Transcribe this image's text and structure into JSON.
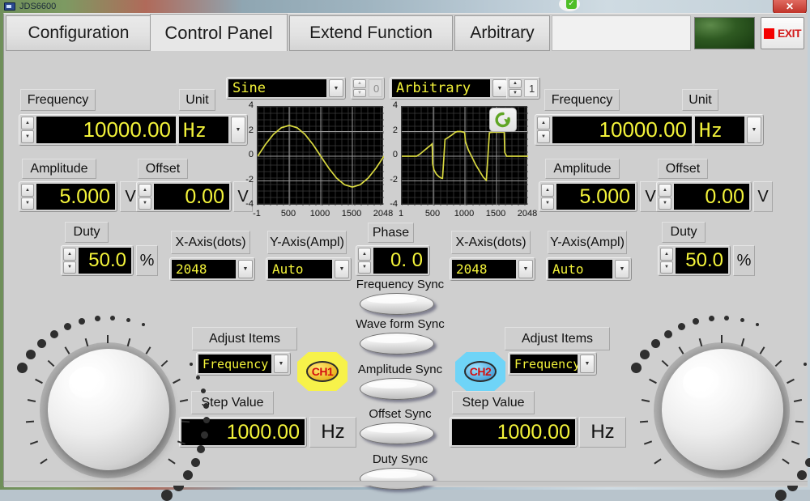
{
  "window": {
    "title": "JDS6600",
    "close_label": "✕"
  },
  "tabs": [
    {
      "label": "Configuration",
      "active": false
    },
    {
      "label": "Control Panel",
      "active": true
    },
    {
      "label": "Extend Function",
      "active": false
    },
    {
      "label": "Arbitrary",
      "active": false
    }
  ],
  "toolbar": {
    "exit_label": "EXIT",
    "exit_icon": "red-square-icon",
    "lamp_color": "#2f5a22"
  },
  "colors": {
    "lcd_bg": "#000000",
    "lcd_text": "#f3f33a",
    "panel_bg": "#cfcfcf",
    "exit_red": "#d21b1b",
    "ch1_badge": "#f7f24a",
    "ch2_badge": "#6fd4f7",
    "wave_trace": "#d8d840"
  },
  "ch1": {
    "waveform": {
      "value": "Sine",
      "index": "0",
      "index_disabled": true
    },
    "frequency": {
      "label": "Frequency",
      "value": "10000.00"
    },
    "unit": {
      "label": "Unit",
      "value": "Hz"
    },
    "amplitude": {
      "label": "Amplitude",
      "value": "5.000",
      "unit": "V"
    },
    "offset": {
      "label": "Offset",
      "value": "0.00",
      "unit": "V"
    },
    "duty": {
      "label": "Duty",
      "value": "50.0",
      "unit": "%"
    },
    "xaxis": {
      "label": "X-Axis(dots)",
      "value": "2048"
    },
    "yaxis": {
      "label": "Y-Axis(Ampl)",
      "value": "Auto"
    },
    "adjust_items": {
      "label": "Adjust Items",
      "value": "Frequency"
    },
    "step_value": {
      "label": "Step Value",
      "value": "1000.00",
      "unit": "Hz"
    },
    "badge": "CH1"
  },
  "ch2": {
    "waveform": {
      "value": "Arbitrary",
      "index": "1",
      "index_disabled": false
    },
    "frequency": {
      "label": "Frequency",
      "value": "10000.00"
    },
    "unit": {
      "label": "Unit",
      "value": "Hz"
    },
    "amplitude": {
      "label": "Amplitude",
      "value": "5.000",
      "unit": "V"
    },
    "offset": {
      "label": "Offset",
      "value": "0.00",
      "unit": "V"
    },
    "duty": {
      "label": "Duty",
      "value": "50.0",
      "unit": "%"
    },
    "xaxis": {
      "label": "X-Axis(dots)",
      "value": "2048"
    },
    "yaxis": {
      "label": "Y-Axis(Ampl)",
      "value": "Auto"
    },
    "adjust_items": {
      "label": "Adjust Items",
      "value": "Frequency"
    },
    "step_value": {
      "label": "Step Value",
      "value": "1000.00",
      "unit": "Hz"
    },
    "badge": "CH2",
    "refresh_icon": "refresh-icon"
  },
  "phase": {
    "label": "Phase",
    "value": "0. 0"
  },
  "sync": [
    {
      "label": "Frequency Sync"
    },
    {
      "label": "Wave form Sync"
    },
    {
      "label": "Amplitude Sync"
    },
    {
      "label": "Offset Sync"
    },
    {
      "label": "Duty  Sync"
    }
  ],
  "chart_data": [
    {
      "type": "line",
      "title": "CH1 Waveform Preview",
      "waveform": "Sine",
      "xlabel": "",
      "ylabel": "",
      "xlim": [
        -1,
        2048
      ],
      "ylim": [
        -4,
        4
      ],
      "xticks": [
        "-1",
        "500",
        "1000",
        "1500",
        "2048"
      ],
      "yticks": [
        "4",
        "2",
        "0",
        "-2",
        "-4"
      ],
      "grid": true,
      "series": [
        {
          "name": "Sine",
          "color": "#d8d840",
          "amplitude": 2.5,
          "cycles": 1,
          "points_x": [
            0,
            128,
            256,
            384,
            512,
            640,
            768,
            896,
            1024,
            1152,
            1280,
            1408,
            1536,
            1664,
            1792,
            1920,
            2048
          ],
          "points_y": [
            0,
            0.96,
            1.77,
            2.31,
            2.5,
            2.31,
            1.77,
            0.96,
            0,
            -0.96,
            -1.77,
            -2.31,
            -2.5,
            -2.31,
            -1.77,
            -0.96,
            0
          ]
        }
      ]
    },
    {
      "type": "line",
      "title": "CH2 Waveform Preview",
      "waveform": "Arbitrary",
      "xlabel": "",
      "ylabel": "",
      "xlim": [
        -1,
        2048
      ],
      "ylim": [
        -4,
        4
      ],
      "xticks": [
        "1",
        "500",
        "1000",
        "1500",
        "2048"
      ],
      "yticks": [
        "4",
        "2",
        "0",
        "-2",
        "-4"
      ],
      "grid": true,
      "series": [
        {
          "name": "Arbitrary 1",
          "color": "#d8d840",
          "points_x": [
            0,
            240,
            300,
            360,
            420,
            470,
            490,
            495,
            500,
            520,
            560,
            600,
            640,
            660,
            670,
            700,
            760,
            820,
            870,
            900,
            960,
            1000,
            1020,
            1030,
            1080,
            1140,
            1200,
            1260,
            1320,
            1360,
            1370,
            1380,
            1420,
            1470,
            1500,
            1620,
            1660,
            1670,
            1700,
            1800,
            2048
          ],
          "points_y": [
            0,
            0,
            0.2,
            0.45,
            0.7,
            0.9,
            1.0,
            0.5,
            -0.6,
            -1.1,
            -1.45,
            -1.65,
            -1.78,
            -1.8,
            -1.0,
            1.35,
            1.55,
            1.75,
            1.95,
            2.0,
            2.0,
            1.95,
            1.9,
            1.2,
            0.5,
            -0.1,
            -0.7,
            -1.2,
            -1.7,
            -1.9,
            -1.95,
            -1.3,
            1.9,
            1.95,
            1.95,
            1.95,
            1.95,
            0.3,
            0,
            0,
            0
          ]
        }
      ]
    }
  ]
}
